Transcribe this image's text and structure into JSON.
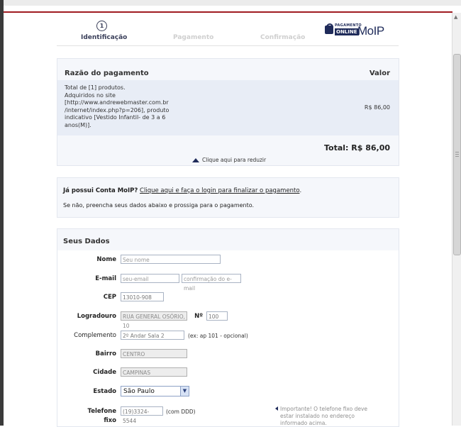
{
  "steps": {
    "step1": {
      "number": "1",
      "label": "Identificação"
    },
    "step2": {
      "label": "Pagamento"
    },
    "step3": {
      "label": "Confirmação"
    }
  },
  "logo": {
    "small_text": "PAGAMENTO",
    "online_text": "ONLINE",
    "brand": "MoIP"
  },
  "payment": {
    "header_reason": "Razão do pagamento",
    "header_value": "Valor",
    "description_lines": [
      "Total de [1] produtos.",
      "Adquiridos no site",
      "[http://www.andrewebmaster.com.br",
      "/internet/index.php?p=206], produto",
      "indicativo [Vestido Infantil- de 3 a 6",
      "anos(M)]."
    ],
    "price": "R$ 86,00",
    "total": "Total: R$ 86,00",
    "reduce_link": "Clique aqui para reduzir"
  },
  "login": {
    "question": "Já possui Conta MoIP?",
    "link": "Clique aqui e faça o login para finalizar o pagamento",
    "period": ".",
    "info": "Se não, preencha seus dados abaixo e prossiga para o pagamento."
  },
  "form": {
    "title": "Seus Dados",
    "nome": {
      "label": "Nome",
      "placeholder": "Seu nome"
    },
    "email": {
      "label": "E-mail",
      "placeholder": "seu-email",
      "confirm_placeholder": "confirmação do e-mail"
    },
    "cep": {
      "label": "CEP",
      "value": "13010-908"
    },
    "logradouro": {
      "label": "Logradouro",
      "value": "RUA GENERAL OSÓRIO, 10"
    },
    "numero": {
      "label": "Nº",
      "value": "100"
    },
    "complemento": {
      "label": "Complemento",
      "value": "2º Andar Sala 2",
      "hint": "(ex: ap 101 - opcional)"
    },
    "bairro": {
      "label": "Bairro",
      "value": "CENTRO"
    },
    "cidade": {
      "label": "Cidade",
      "value": "CAMPINAS"
    },
    "estado": {
      "label": "Estado",
      "value": "São Paulo"
    },
    "telefone": {
      "label_line1": "Telefone",
      "label_line2": "fixo",
      "value": "(19)3324-5544",
      "hint": "(com DDD)"
    },
    "tip_lines": [
      "Importante! O telefone fixo deve",
      "estar instalado no endereço",
      "informado acima."
    ]
  },
  "icons": {
    "step_badge": "circle-number-icon",
    "reduce": "triangle-up-icon",
    "select": "chevron-down-icon",
    "tip": "arrow-left-icon",
    "lock": "lock-icon"
  },
  "colors": {
    "accent_red": "#a01c22",
    "brand_navy": "#1f2b5a",
    "panel_bg": "#f5f7fb",
    "panel_body": "#e8edf6"
  }
}
